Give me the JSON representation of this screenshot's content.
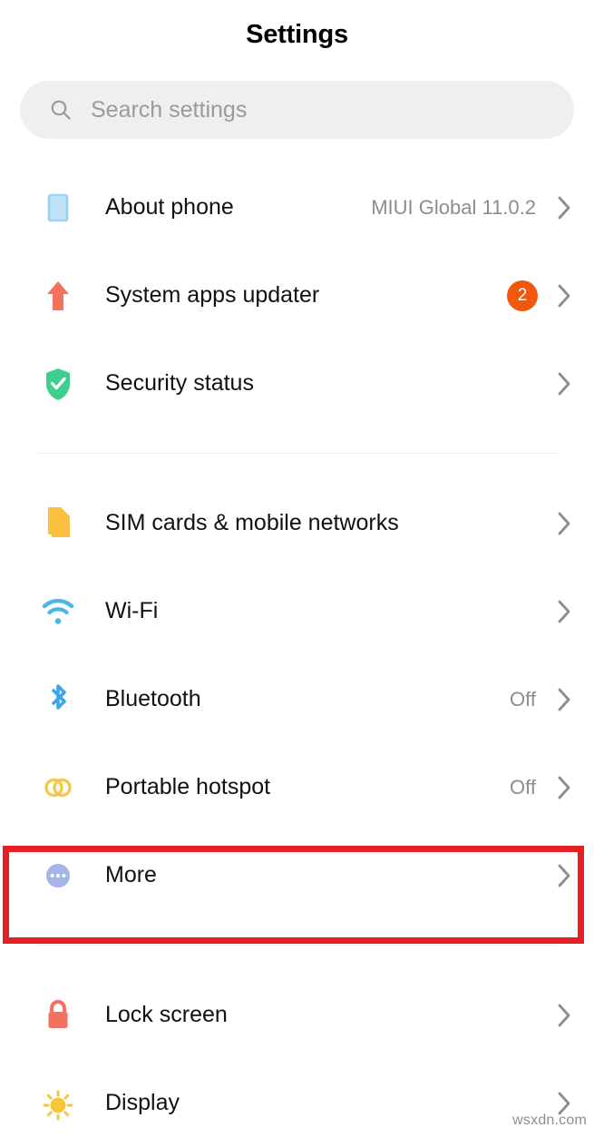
{
  "header": {
    "title": "Settings"
  },
  "search": {
    "icon": "search-icon",
    "placeholder": "Search settings",
    "value": ""
  },
  "groups": [
    {
      "name": "system-group",
      "items": [
        {
          "label": "About phone",
          "value": "MIUI Global 11.0.2",
          "badge": "",
          "icon": "phone-icon",
          "icon_color": "#9bd2f2",
          "chevron": "chevron-right-icon",
          "highlighted": false
        },
        {
          "label": "System apps updater",
          "value": "",
          "badge": "2",
          "icon": "up-arrow-icon",
          "icon_color": "#f4705f",
          "chevron": "chevron-right-icon",
          "highlighted": false
        },
        {
          "label": "Security status",
          "value": "",
          "badge": "",
          "icon": "shield-check-icon",
          "icon_color": "#3ecf8e",
          "chevron": "chevron-right-icon",
          "highlighted": false
        }
      ]
    },
    {
      "name": "connectivity-group",
      "items": [
        {
          "label": "SIM cards & mobile networks",
          "value": "",
          "badge": "",
          "icon": "sim-card-icon",
          "icon_color": "#fbc03d",
          "chevron": "chevron-right-icon",
          "highlighted": false
        },
        {
          "label": "Wi-Fi",
          "value": "",
          "badge": "",
          "icon": "wifi-icon",
          "icon_color": "#4db6e8",
          "chevron": "chevron-right-icon",
          "highlighted": false
        },
        {
          "label": "Bluetooth",
          "value": "Off",
          "badge": "",
          "icon": "bluetooth-icon",
          "icon_color": "#3ba7e8",
          "chevron": "chevron-right-icon",
          "highlighted": false
        },
        {
          "label": "Portable hotspot",
          "value": "Off",
          "badge": "",
          "icon": "hotspot-rings-icon",
          "icon_color": "#f2c94c",
          "chevron": "chevron-right-icon",
          "highlighted": false
        },
        {
          "label": "More",
          "value": "",
          "badge": "",
          "icon": "more-dots-icon",
          "icon_color": "#a3b4e8",
          "chevron": "chevron-right-icon",
          "highlighted": true
        }
      ]
    },
    {
      "name": "personalization-group",
      "items": [
        {
          "label": "Lock screen",
          "value": "",
          "badge": "",
          "icon": "lock-icon",
          "icon_color": "#f4705f",
          "chevron": "chevron-right-icon",
          "highlighted": false
        },
        {
          "label": "Display",
          "value": "",
          "badge": "",
          "icon": "sun-icon",
          "icon_color": "#f8c43a",
          "chevron": "chevron-right-icon",
          "highlighted": false
        }
      ]
    }
  ],
  "highlight": {
    "target_label": "More",
    "color": "#e51f23"
  },
  "watermark": {
    "text": "wsxdn.com"
  },
  "colors": {
    "badge_background": "#f0570f",
    "search_background": "#efefef",
    "value_text": "#8d8d8d",
    "divider": "#ededed"
  }
}
